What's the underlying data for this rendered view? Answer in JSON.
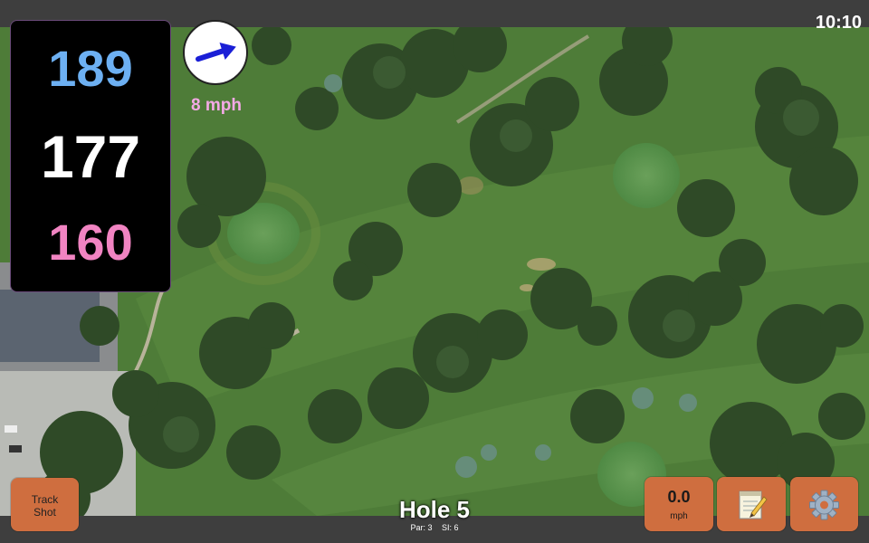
{
  "status": {
    "time": "10:10"
  },
  "distances": {
    "back": "189",
    "center": "177",
    "front": "160"
  },
  "wind": {
    "speed": "8 mph",
    "direction": "east-northeast"
  },
  "hole": {
    "title": "Hole 5",
    "par": "Par: 3",
    "si": "SI: 6"
  },
  "buttons": {
    "track_line1": "Track",
    "track_line2": "Shot",
    "wind_value": "0.0",
    "wind_unit": "mph",
    "notes_icon": "notepad-icon",
    "settings_icon": "gear-icon"
  },
  "colors": {
    "back": "#6db0f2",
    "center": "#ffffff",
    "front": "#f184c2",
    "button": "#cf6e3f",
    "wind_label": "#f4a9e6"
  }
}
